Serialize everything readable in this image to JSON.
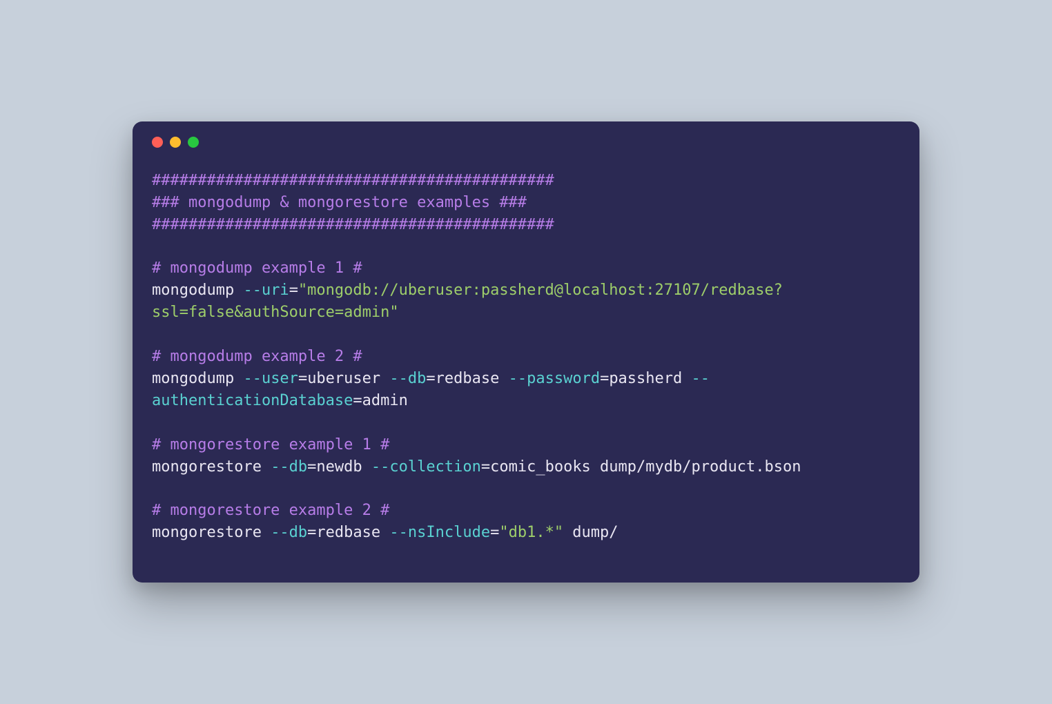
{
  "colors": {
    "bg": "#c7d0db",
    "terminal_bg": "#2b2953",
    "text": "#e9e6f2",
    "comment": "#b77de8",
    "flag": "#5ad1d1",
    "string": "#9ece6a",
    "dot_red": "#ff5f57",
    "dot_yellow": "#febc2e",
    "dot_green": "#28c840"
  },
  "code": {
    "header1": "############################################",
    "header2": "### mongodump & mongorestore examples ###",
    "header3": "############################################",
    "ex1_comment": "# mongodump example 1 #",
    "ex1_cmd": "mongodump ",
    "ex1_flag": "--uri",
    "ex1_eq": "=",
    "ex1_str": "\"mongodb://uberuser:passherd@localhost:27107/redbase?ssl=false&authSource=admin\"",
    "ex2_comment": "# mongodump example 2 #",
    "ex2_cmd": "mongodump ",
    "ex2_flag_user": "--user",
    "ex2_val_user": "uberuser ",
    "ex2_flag_db": "--db",
    "ex2_val_db": "redbase ",
    "ex2_flag_pass": "--password",
    "ex2_val_pass": "passherd ",
    "ex2_flag_auth": "--authenticationDatabase",
    "ex2_val_auth": "admin",
    "ex3_comment": "# mongorestore example 1 #",
    "ex3_cmd": "mongorestore ",
    "ex3_flag_db": "--db",
    "ex3_val_db": "newdb ",
    "ex3_flag_coll": "--collection",
    "ex3_val_coll": "comic_books dump/mydb/product.bson",
    "ex4_comment": "# mongorestore example 2 #",
    "ex4_cmd": "mongorestore ",
    "ex4_flag_db": "--db",
    "ex4_val_db": "redbase ",
    "ex4_flag_ns": "--nsInclude",
    "ex4_eq": "=",
    "ex4_str": "\"db1.*\"",
    "ex4_tail": " dump/"
  }
}
